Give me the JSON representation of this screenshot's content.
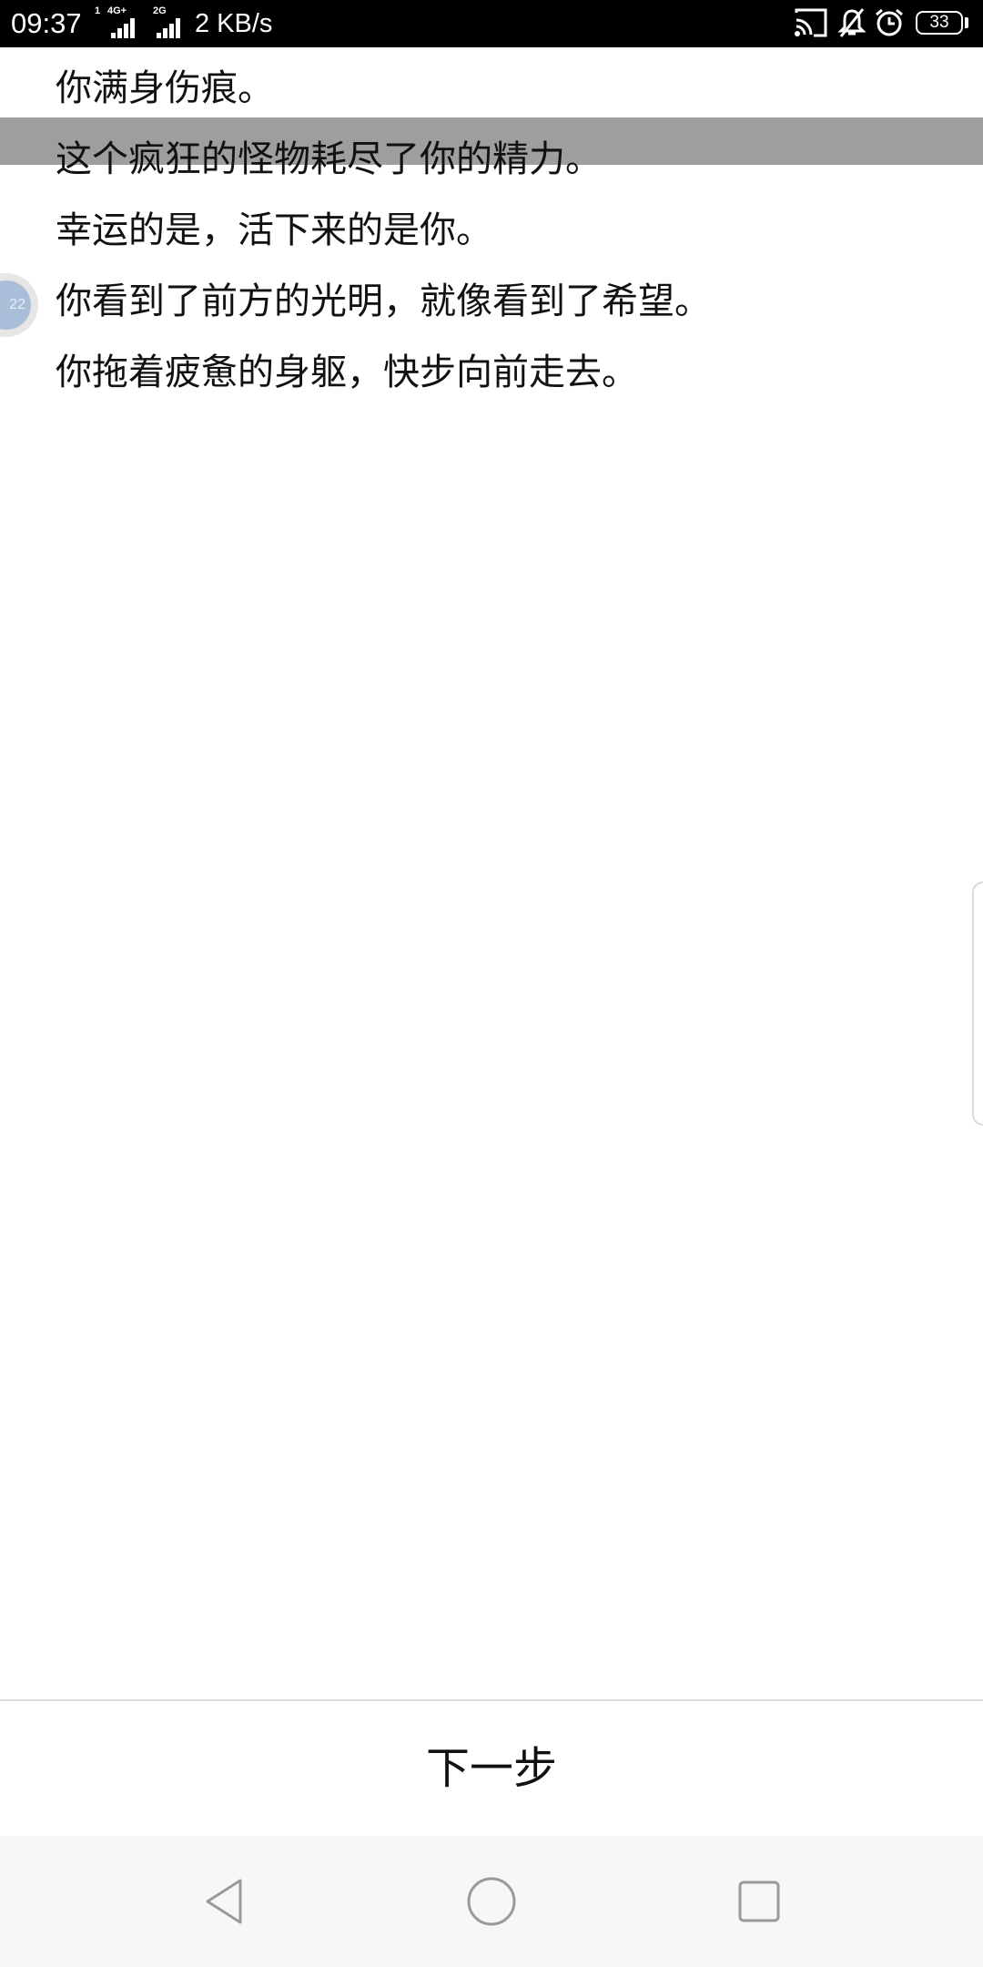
{
  "status_bar": {
    "time": "09:37",
    "sim1_label": "4G+",
    "sim1_prefix": "1",
    "sim2_label": "2G",
    "net_speed": "2 KB/s",
    "battery": "33"
  },
  "story": {
    "lines": [
      "你满身伤痕。",
      "这个疯狂的怪物耗尽了你的精力。",
      "幸运的是，活下来的是你。",
      "你看到了前方的光明，就像看到了希望。",
      "你拖着疲惫的身躯，快步向前走去。"
    ]
  },
  "float_bubble": {
    "text": "22"
  },
  "footer": {
    "next_label": "下一步"
  },
  "colors": {
    "status_bar_bg": "#000000",
    "highlight": "#9e9e9e",
    "nav_bar_bg": "#f7f7f7",
    "bubble": "#a9bed8"
  }
}
